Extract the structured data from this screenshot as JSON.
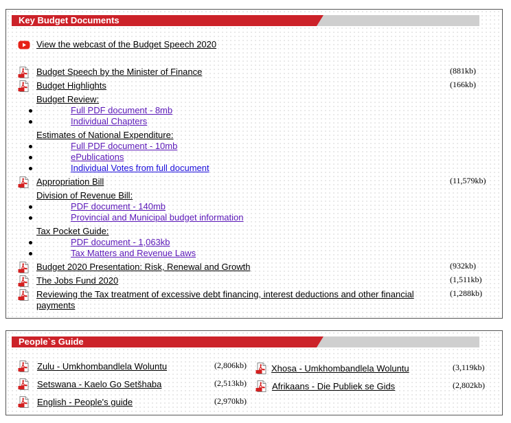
{
  "key_budget": {
    "title": "Key Budget Documents",
    "webcast_label": "View the webcast of the Budget Speech 2020",
    "speech": {
      "label": "Budget Speech by the Minister of Finance",
      "size": "(881kb)"
    },
    "highlights": {
      "label": "Budget Highlights",
      "size": "(166kb)"
    },
    "review": {
      "label": "Budget Review:",
      "items": [
        "Full PDF document - 8mb",
        "Individual Chapters"
      ]
    },
    "estimates": {
      "label": "Estimates of National Expenditure:",
      "items": [
        "Full PDF document - 10mb",
        "ePublications",
        "Individual Votes from full document"
      ]
    },
    "appropriation": {
      "label": "Appropriation Bill",
      "size": "(11,579kb)"
    },
    "revenue": {
      "label": "Division of Revenue Bill:",
      "items": [
        "PDF document - 140mb",
        "Provincial and Municipal budget information"
      ]
    },
    "pocket": {
      "label": "Tax Pocket Guide:",
      "items": [
        "PDF document - 1,063kb",
        "Tax Matters and Revenue Laws"
      ]
    },
    "presentation": {
      "label": "Budget 2020 Presentation: Risk, Renewal and Growth",
      "size": "(932kb)"
    },
    "jobs": {
      "label": "The Jobs Fund 2020",
      "size": "(1,511kb)"
    },
    "reviewing": {
      "label": "Reviewing the Tax treatment of excessive debt financing, interest deductions and other financial payments",
      "size": "(1,288kb)"
    }
  },
  "peoples_guide": {
    "title": "People`s Guide",
    "zulu": {
      "label": "Zulu - Umkhombandlela Woluntu",
      "size": "(2,806kb)"
    },
    "setswana": {
      "label": "Setswana - Kaelo Go Setšhaba",
      "size": "(2,513kb)"
    },
    "english": {
      "label": "English - People's guide",
      "size": "(2,970kb)"
    },
    "xhosa": {
      "label": "Xhosa - Umkhombandlela Woluntu",
      "size": "(3,119kb)"
    },
    "afrikaans": {
      "label": "Afrikaans - Die Publiek se Gids",
      "size": "(2,802kb)"
    }
  },
  "colors": {
    "header_red": "#cc2229",
    "header_grey": "#cfcfcf",
    "visited_link": "#5b18b8",
    "link_blue": "#1a0ddb"
  },
  "icons": {
    "pdf": "pdf-icon",
    "video": "youtube-icon"
  }
}
